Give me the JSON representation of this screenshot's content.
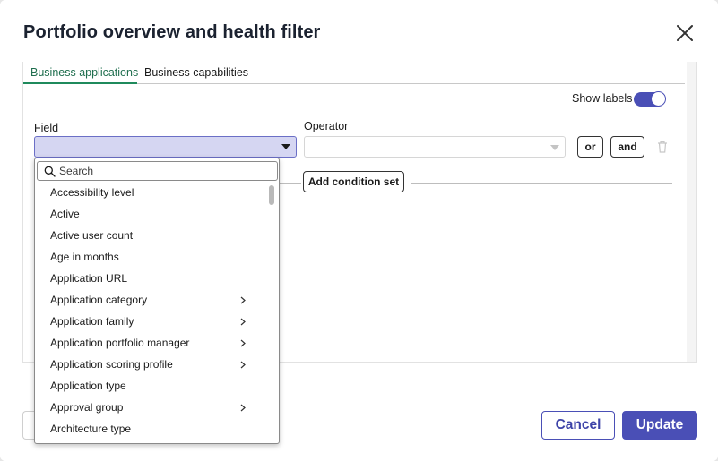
{
  "dialog": {
    "title": "Portfolio overview and health filter"
  },
  "tabs": [
    {
      "label": "Business applications",
      "active": true
    },
    {
      "label": "Business capabilities",
      "active": false
    }
  ],
  "show_labels": {
    "label": "Show labels",
    "enabled": true
  },
  "condition": {
    "field_label": "Field",
    "field_value": "",
    "operator_label": "Operator",
    "operator_value": "",
    "or_label": "or",
    "and_label": "and"
  },
  "add_condition_set_label": "Add condition set",
  "field_dropdown": {
    "search_placeholder": "Search",
    "items": [
      {
        "label": "Accessibility level",
        "has_submenu": false
      },
      {
        "label": "Active",
        "has_submenu": false
      },
      {
        "label": "Active user count",
        "has_submenu": false
      },
      {
        "label": "Age in months",
        "has_submenu": false
      },
      {
        "label": "Application URL",
        "has_submenu": false
      },
      {
        "label": "Application category",
        "has_submenu": true
      },
      {
        "label": "Application family",
        "has_submenu": true
      },
      {
        "label": "Application portfolio manager",
        "has_submenu": true
      },
      {
        "label": "Application scoring profile",
        "has_submenu": true
      },
      {
        "label": "Application type",
        "has_submenu": false
      },
      {
        "label": "Approval group",
        "has_submenu": true
      },
      {
        "label": "Architecture type",
        "has_submenu": false
      }
    ]
  },
  "footer": {
    "cancel_label": "Cancel",
    "update_label": "Update"
  },
  "colors": {
    "accent": "#4a4fb6",
    "tab_active": "#1f8a5c",
    "field_selected_bg": "#d5d6f2"
  }
}
